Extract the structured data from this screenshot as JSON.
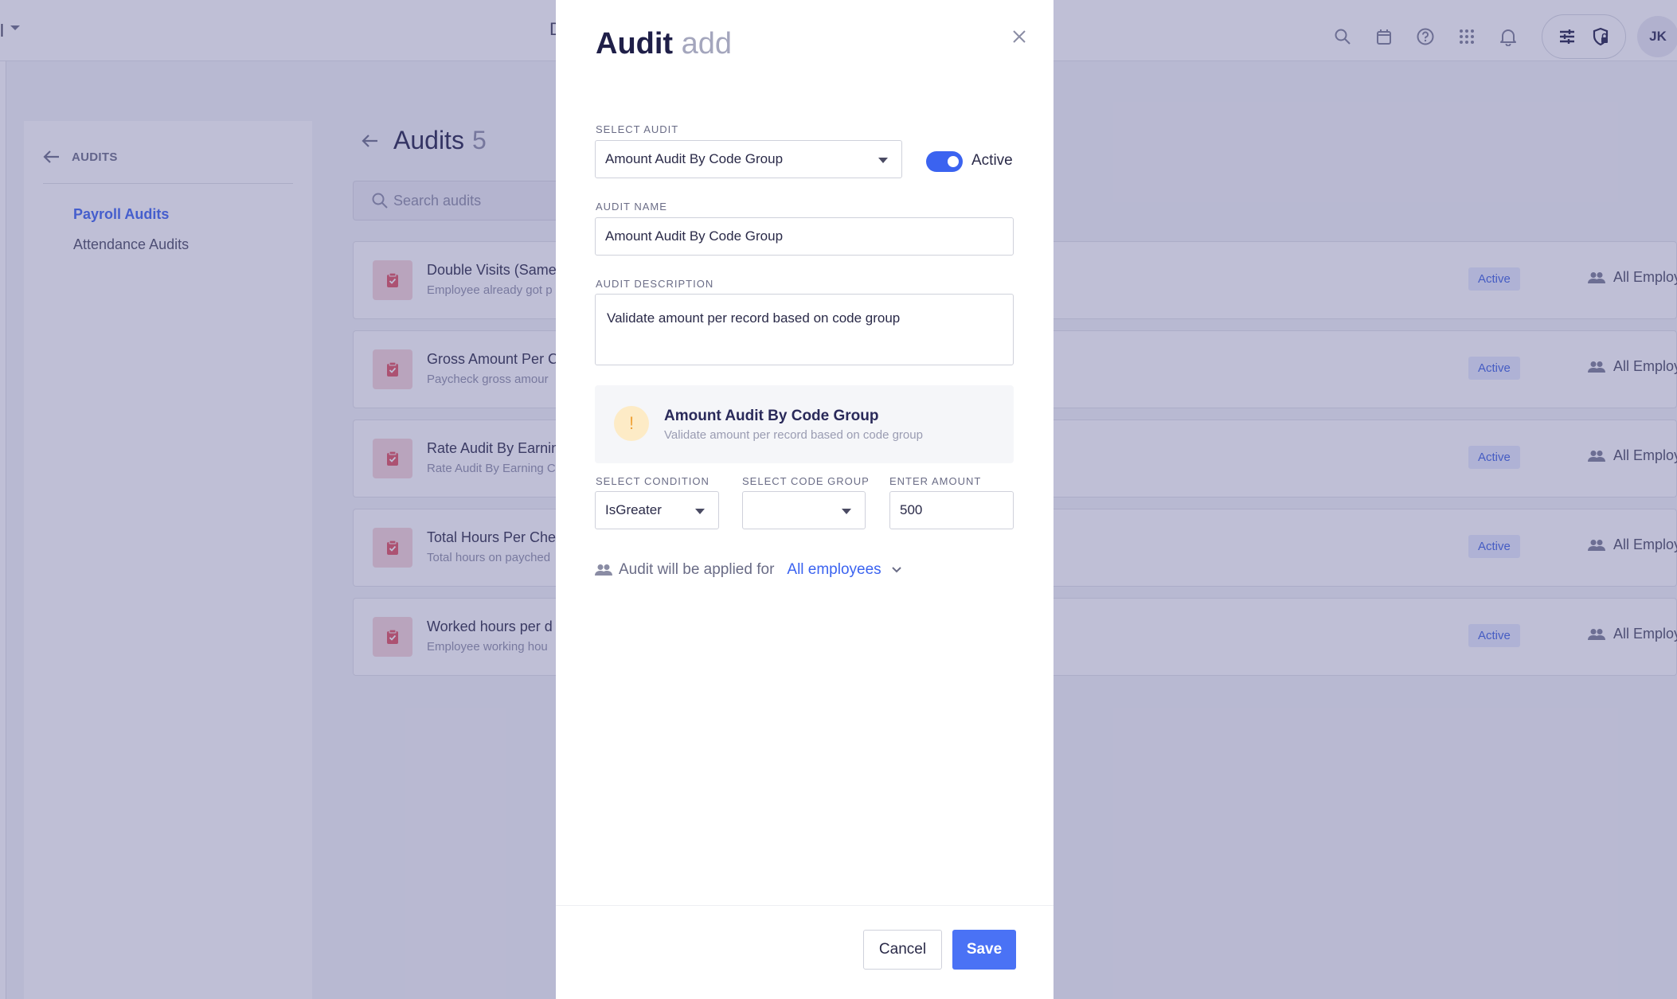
{
  "app": {
    "left_fragment": "l",
    "title_fragment": "D",
    "user_initials": "JK",
    "toolbar_icons": [
      "search-icon",
      "calendar-icon",
      "help-icon",
      "apps-grid-icon",
      "bell-icon",
      "filters-icon",
      "shield-lock-icon"
    ]
  },
  "sidebar": {
    "heading": "AUDITS",
    "items": [
      {
        "label": "Payroll Audits",
        "active": true
      },
      {
        "label": "Attendance Audits",
        "active": false
      }
    ]
  },
  "main": {
    "title": "Audits",
    "count": "5",
    "search_placeholder": "Search audits",
    "rows": [
      {
        "name": "Double Visits (Same",
        "desc": "Employee already got p",
        "status": "Active",
        "applies_to": "All Employ"
      },
      {
        "name": "Gross Amount Per C",
        "desc": "Paycheck gross amour",
        "status": "Active",
        "applies_to": "All Employ"
      },
      {
        "name": "Rate Audit By Earnin",
        "desc": "Rate Audit By Earning C",
        "status": "Active",
        "applies_to": "All Employ"
      },
      {
        "name": "Total Hours Per Che",
        "desc": "Total hours on payched",
        "status": "Active",
        "applies_to": "All Employ"
      },
      {
        "name": "Worked hours per d",
        "desc": "Employee working hou",
        "status": "Active",
        "applies_to": "All Employ"
      }
    ]
  },
  "modal": {
    "title": "Audit",
    "title_suffix": "add",
    "select_audit_label": "SELECT AUDIT",
    "select_audit_value": "Amount Audit By Code Group",
    "active_label": "Active",
    "active_on": true,
    "audit_name_label": "AUDIT NAME",
    "audit_name_value": "Amount Audit By Code Group",
    "audit_description_label": "AUDIT DESCRIPTION",
    "audit_description_value": "Validate amount per record based on code group",
    "info_title": "Amount Audit By Code Group",
    "info_desc": "Validate amount per record based on code group",
    "info_icon": "!",
    "condition_label": "SELECT CONDITION",
    "condition_value": "IsGreater",
    "code_group_label": "SELECT CODE GROUP",
    "code_group_value": "",
    "amount_label": "ENTER AMOUNT",
    "amount_value": "500",
    "applied_text": "Audit will be applied for",
    "applied_link": "All employees",
    "cancel_label": "Cancel",
    "save_label": "Save"
  },
  "colors": {
    "accent": "#3b63f0",
    "save_button": "#4a72f5",
    "badge_bg": "#e6ebfd",
    "audit_icon_bg": "#f6d4d7",
    "audit_icon_fg": "#e0505e",
    "warning_bg": "#fdebc6",
    "overlay": "rgba(88,88,148,0.38)"
  }
}
